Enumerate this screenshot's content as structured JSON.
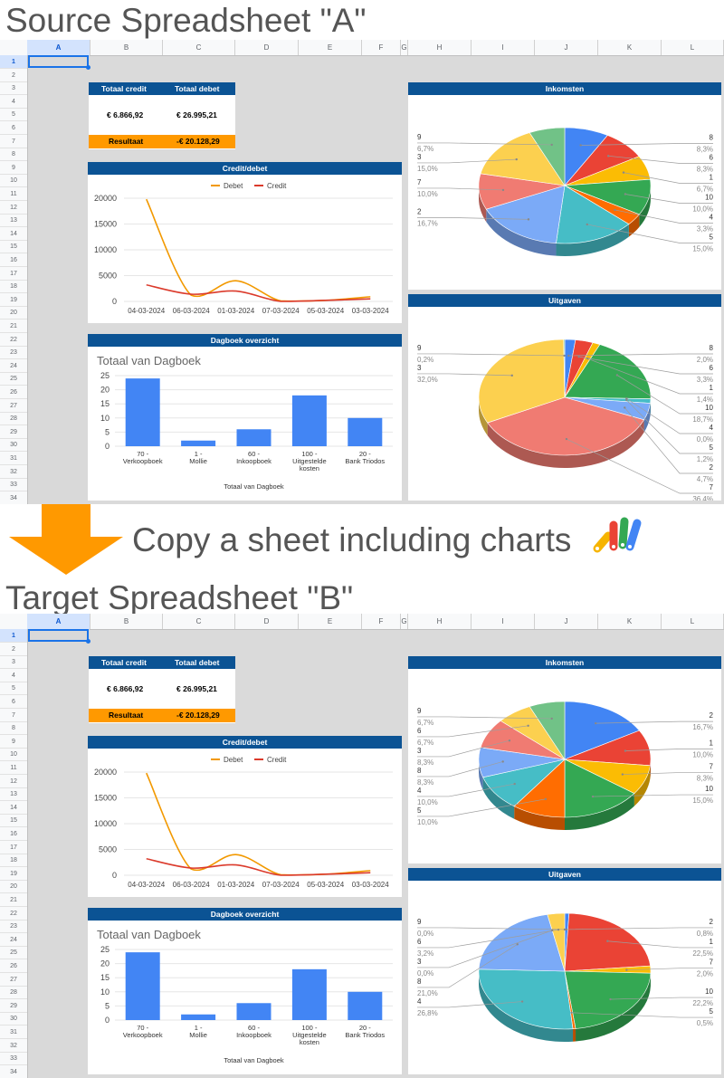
{
  "headline_source": "Source Spreadsheet \"A\"",
  "headline_target": "Target Spreadsheet \"B\"",
  "transition_text": "Copy a sheet including charts",
  "columns": [
    "A",
    "B",
    "C",
    "D",
    "E",
    "F",
    "G",
    "H",
    "I",
    "J",
    "K",
    "L"
  ],
  "rows": [
    "1",
    "2",
    "3",
    "4",
    "5",
    "6",
    "7",
    "8",
    "9",
    "10",
    "11",
    "12",
    "13",
    "14",
    "15",
    "16",
    "17",
    "18",
    "19",
    "20",
    "21",
    "22",
    "23",
    "24",
    "25",
    "26",
    "27",
    "28",
    "29",
    "30",
    "31",
    "32",
    "33",
    "34"
  ],
  "source": {
    "summary": {
      "credit_label": "Totaal credit",
      "debit_label": "Totaal debet",
      "credit_value": "€ 6.866,92",
      "debit_value": "€ 26.995,21",
      "result_label": "Resultaat",
      "result_value": "-€ 20.128,29"
    },
    "line_title": "Credit/debet",
    "bar_panel_title": "Dagboek overzicht",
    "pie1_title": "Inkomsten",
    "pie2_title": "Uitgaven"
  },
  "target": {
    "summary": {
      "credit_label": "Totaal credit",
      "debit_label": "Totaal debet",
      "credit_value": "€ 6.866,92",
      "debit_value": "€ 26.995,21",
      "result_label": "Resultaat",
      "result_value": "-€ 20.128,29"
    },
    "line_title": "Credit/debet",
    "bar_panel_title": "Dagboek overzicht",
    "pie1_title": "Inkomsten",
    "pie2_title": "Uitgaven"
  },
  "colors": {
    "blue_header": "#0b5394",
    "orange": "#ff9900",
    "debet": "#f29900",
    "credit": "#db3a2b",
    "bar": "#4285f4"
  },
  "icons": {
    "arrow": "down-arrow-icon",
    "app": "apps-script-icon"
  },
  "chart_data": [
    {
      "id": "source-line",
      "type": "line",
      "categories": [
        "04-03-2024",
        "06-03-2024",
        "01-03-2024",
        "07-03-2024",
        "05-03-2024",
        "03-03-2024"
      ],
      "series": [
        {
          "name": "Debet",
          "values": [
            19800,
            1200,
            4000,
            100,
            200,
            900
          ]
        },
        {
          "name": "Credit",
          "values": [
            3200,
            1400,
            2000,
            0,
            200,
            500
          ]
        }
      ],
      "ylim": [
        0,
        20000
      ],
      "yticks": [
        "0",
        "5000",
        "10000",
        "15000",
        "20000"
      ],
      "legend": "top"
    },
    {
      "id": "source-bar",
      "type": "bar",
      "title": "Totaal van Dagboek",
      "categories": [
        "70 - Verkoopboek",
        "1 - Mollie",
        "60 - Inkoopboek",
        "100 - Uitgestelde kosten",
        "20 - Bank Triodos"
      ],
      "values": [
        24,
        2,
        6,
        18,
        10
      ],
      "ylim": [
        0,
        25
      ],
      "yticks": [
        "0",
        "5",
        "10",
        "15",
        "20",
        "25"
      ],
      "xlabel": "Totaal van Dagboek"
    },
    {
      "id": "source-pie-inkomsten",
      "type": "pie",
      "slices": [
        {
          "label": "8",
          "pct": "8,3%",
          "value": 8.3,
          "color": "#4285f4"
        },
        {
          "label": "6",
          "pct": "8,3%",
          "value": 8.3,
          "color": "#ea4335"
        },
        {
          "label": "1",
          "pct": "6,7%",
          "value": 6.7,
          "color": "#fbbc04"
        },
        {
          "label": "10",
          "pct": "10,0%",
          "value": 10.0,
          "color": "#34a853"
        },
        {
          "label": "4",
          "pct": "3,3%",
          "value": 3.3,
          "color": "#ff6d01"
        },
        {
          "label": "5",
          "pct": "15,0%",
          "value": 15.0,
          "color": "#46bdc6"
        },
        {
          "label": "2",
          "pct": "16,7%",
          "value": 16.7,
          "color": "#7baaf7"
        },
        {
          "label": "7",
          "pct": "10,0%",
          "value": 10.0,
          "color": "#f07b72"
        },
        {
          "label": "3",
          "pct": "15,0%",
          "value": 15.0,
          "color": "#fcd04f"
        },
        {
          "label": "9",
          "pct": "6,7%",
          "value": 6.7,
          "color": "#71c287"
        }
      ]
    },
    {
      "id": "source-pie-uitgaven",
      "type": "pie",
      "slices": [
        {
          "label": "8",
          "pct": "2,0%",
          "value": 2.0,
          "color": "#4285f4"
        },
        {
          "label": "6",
          "pct": "3,3%",
          "value": 3.3,
          "color": "#ea4335"
        },
        {
          "label": "1",
          "pct": "1,4%",
          "value": 1.4,
          "color": "#fbbc04"
        },
        {
          "label": "10",
          "pct": "18,7%",
          "value": 18.7,
          "color": "#34a853"
        },
        {
          "label": "4",
          "pct": "0,0%",
          "value": 0.0,
          "color": "#ff6d01"
        },
        {
          "label": "5",
          "pct": "1,2%",
          "value": 1.2,
          "color": "#46bdc6"
        },
        {
          "label": "2",
          "pct": "4,7%",
          "value": 4.7,
          "color": "#7baaf7"
        },
        {
          "label": "7",
          "pct": "36,4%",
          "value": 36.4,
          "color": "#f07b72"
        },
        {
          "label": "3",
          "pct": "32,0%",
          "value": 32.0,
          "color": "#fcd04f"
        },
        {
          "label": "9",
          "pct": "0,2%",
          "value": 0.2,
          "color": "#71c287"
        }
      ]
    },
    {
      "id": "target-line",
      "type": "line",
      "categories": [
        "04-03-2024",
        "06-03-2024",
        "01-03-2024",
        "07-03-2024",
        "05-03-2024",
        "03-03-2024"
      ],
      "series": [
        {
          "name": "Debet",
          "values": [
            19800,
            1200,
            4000,
            100,
            200,
            900
          ]
        },
        {
          "name": "Credit",
          "values": [
            3200,
            1400,
            2000,
            0,
            200,
            500
          ]
        }
      ],
      "ylim": [
        0,
        20000
      ],
      "yticks": [
        "0",
        "5000",
        "10000",
        "15000",
        "20000"
      ],
      "legend": "top"
    },
    {
      "id": "target-bar",
      "type": "bar",
      "title": "Totaal van Dagboek",
      "categories": [
        "70 - Verkoopboek",
        "1 - Mollie",
        "60 - Inkoopboek",
        "100 - Uitgestelde kosten",
        "20 - Bank Triodos"
      ],
      "values": [
        24,
        2,
        6,
        18,
        10
      ],
      "ylim": [
        0,
        25
      ],
      "yticks": [
        "0",
        "5",
        "10",
        "15",
        "20",
        "25"
      ],
      "xlabel": "Totaal van Dagboek"
    },
    {
      "id": "target-pie-inkomsten",
      "type": "pie",
      "slices": [
        {
          "label": "2",
          "pct": "16,7%",
          "value": 16.7,
          "color": "#4285f4"
        },
        {
          "label": "1",
          "pct": "10,0%",
          "value": 10.0,
          "color": "#ea4335"
        },
        {
          "label": "7",
          "pct": "8,3%",
          "value": 8.3,
          "color": "#fbbc04"
        },
        {
          "label": "10",
          "pct": "15,0%",
          "value": 15.0,
          "color": "#34a853"
        },
        {
          "label": "5",
          "pct": "10,0%",
          "value": 10.0,
          "color": "#ff6d01"
        },
        {
          "label": "4",
          "pct": "10,0%",
          "value": 10.0,
          "color": "#46bdc6"
        },
        {
          "label": "8",
          "pct": "8,3%",
          "value": 8.3,
          "color": "#7baaf7"
        },
        {
          "label": "3",
          "pct": "8,3%",
          "value": 8.3,
          "color": "#f07b72"
        },
        {
          "label": "6",
          "pct": "6,7%",
          "value": 6.7,
          "color": "#fcd04f"
        },
        {
          "label": "9",
          "pct": "6,7%",
          "value": 6.7,
          "color": "#71c287"
        }
      ]
    },
    {
      "id": "target-pie-uitgaven",
      "type": "pie",
      "slices": [
        {
          "label": "2",
          "pct": "0,8%",
          "value": 0.8,
          "color": "#4285f4"
        },
        {
          "label": "1",
          "pct": "22,5%",
          "value": 22.5,
          "color": "#ea4335"
        },
        {
          "label": "7",
          "pct": "2,0%",
          "value": 2.0,
          "color": "#fbbc04"
        },
        {
          "label": "10",
          "pct": "22,2%",
          "value": 22.2,
          "color": "#34a853"
        },
        {
          "label": "5",
          "pct": "0,5%",
          "value": 0.5,
          "color": "#ff6d01"
        },
        {
          "label": "4",
          "pct": "26,8%",
          "value": 26.8,
          "color": "#46bdc6"
        },
        {
          "label": "8",
          "pct": "21,0%",
          "value": 21.0,
          "color": "#7baaf7"
        },
        {
          "label": "3",
          "pct": "0,0%",
          "value": 0.0,
          "color": "#f07b72"
        },
        {
          "label": "6",
          "pct": "3,2%",
          "value": 3.2,
          "color": "#fcd04f"
        },
        {
          "label": "9",
          "pct": "0,0%",
          "value": 0.0,
          "color": "#71c287"
        }
      ]
    }
  ]
}
